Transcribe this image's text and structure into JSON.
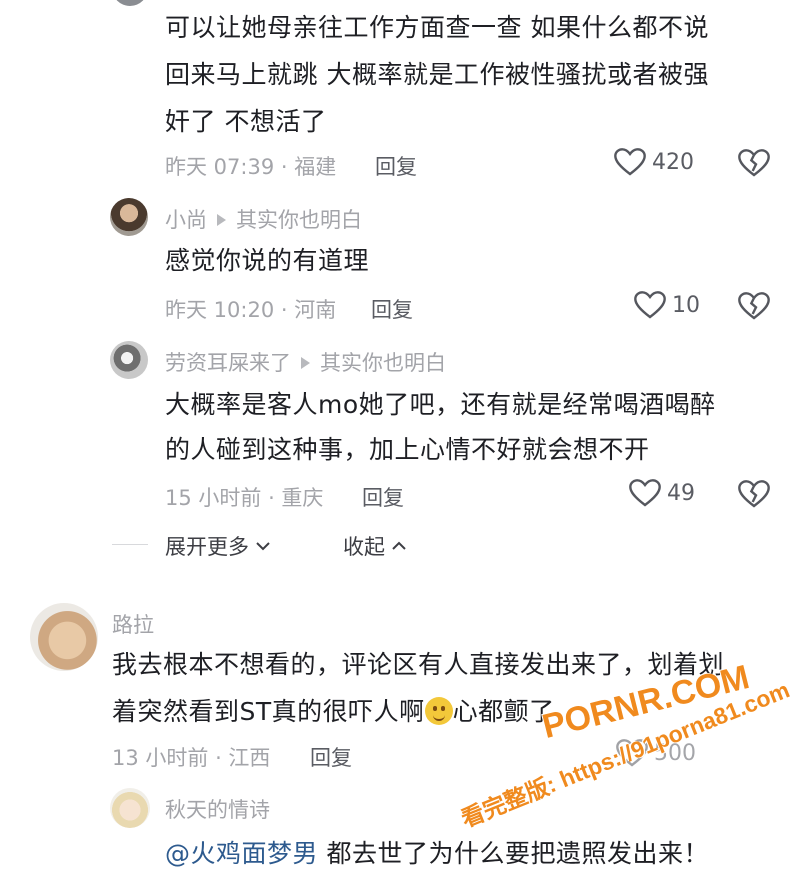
{
  "thread": {
    "top_comment": {
      "text_lines": [
        "可以让她母亲往工作方面查一查  如果什么都不说",
        "回来马上就跳 大概率就是工作被性骚扰或者被强",
        "奸了 不想活了"
      ],
      "meta": "昨天 07:39 · 福建",
      "reply_label": "回复",
      "likes": "420"
    },
    "replies": [
      {
        "name": "小尚",
        "reply_to": "其实你也明白",
        "text_lines": [
          "感觉你说的有道理"
        ],
        "meta": "昨天 10:20 · 河南",
        "reply_label": "回复",
        "likes": "10"
      },
      {
        "name": "劳资耳屎来了",
        "reply_to": "其实你也明白",
        "text_lines": [
          "大概率是客人mo她了吧，还有就是经常喝酒喝醉",
          "的人碰到这种事，加上心情不好就会想不开"
        ],
        "meta": "15 小时前 · 重庆",
        "reply_label": "回复",
        "likes": "49"
      }
    ],
    "expand_label": "展开更多",
    "collapse_label": "收起"
  },
  "comment2": {
    "name": "路拉",
    "text_line1": "我去根本不想看的，评论区有人直接发出来了，划着划",
    "text_line2_a": "着突然看到ST真的很吓人啊",
    "text_line2_b": "心都颤了",
    "meta": "13 小时前 · 江西",
    "reply_label": "回复",
    "likes": "500",
    "reply": {
      "name": "秋天的情诗",
      "mention": "@火鸡面梦男",
      "text": " 都去世了为什么要把遗照发出来！"
    }
  },
  "watermark": {
    "brand": "PORNR.COM",
    "url_line": "看完整版: https://91porna81.com"
  },
  "icons": [
    "heart-icon",
    "broken-heart-icon",
    "chevron-down-icon",
    "chevron-up-icon",
    "smile-emoji-icon"
  ],
  "colors": {
    "text": "#1e1f24",
    "meta": "#a3a4a9",
    "link": "#2d5a8e",
    "watermark": "#f08a1e"
  }
}
